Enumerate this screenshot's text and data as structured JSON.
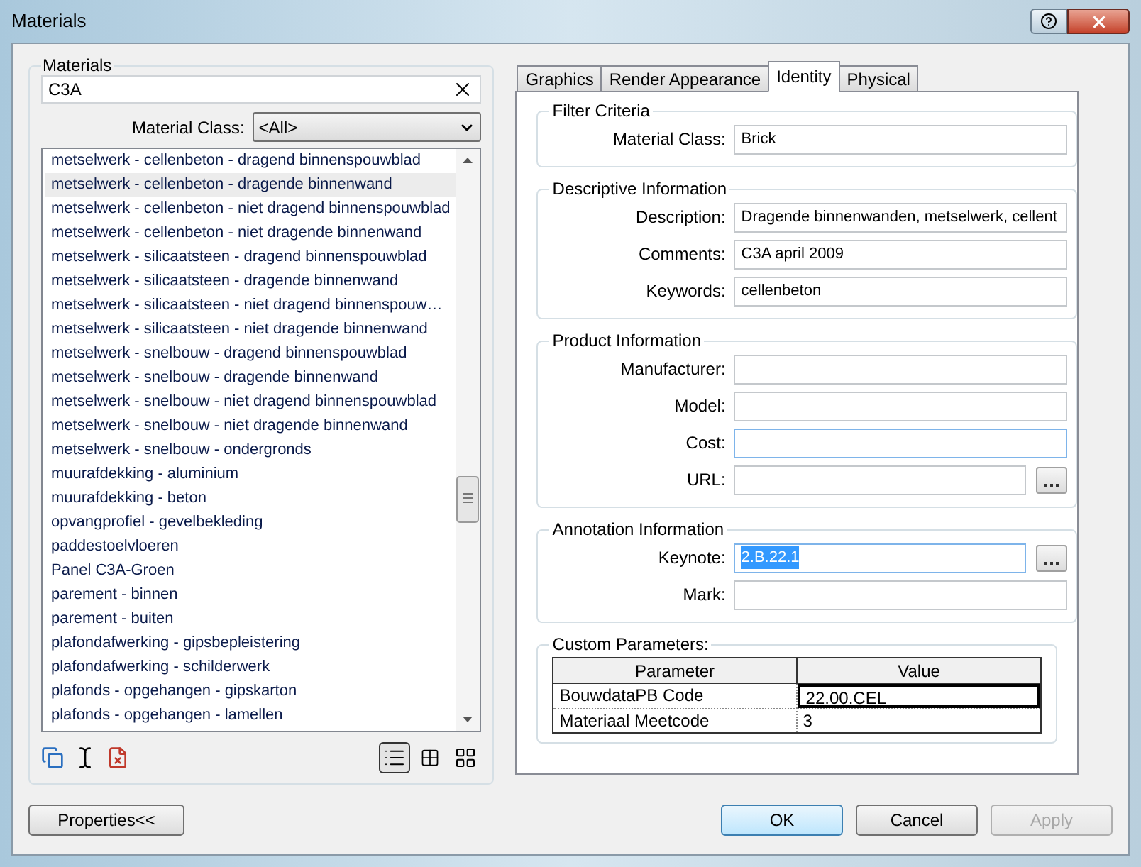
{
  "window": {
    "title": "Materials"
  },
  "materials": {
    "title": "Materials",
    "search": {
      "value": "C3A"
    },
    "material_class": {
      "label": "Material Class:",
      "value": "<All>"
    },
    "items": [
      {
        "label": "metselwerk - cellenbeton - dragend binnenspouwblad",
        "selected": false
      },
      {
        "label": "metselwerk - cellenbeton - dragende binnenwand",
        "selected": true
      },
      {
        "label": "metselwerk - cellenbeton - niet dragend binnenspouwblad",
        "selected": false
      },
      {
        "label": "metselwerk - cellenbeton - niet dragende binnenwand",
        "selected": false
      },
      {
        "label": "metselwerk - silicaatsteen - dragend binnenspouwblad",
        "selected": false
      },
      {
        "label": "metselwerk - silicaatsteen - dragende binnenwand",
        "selected": false
      },
      {
        "label": "metselwerk - silicaatsteen - niet dragend binnenspouw…",
        "selected": false
      },
      {
        "label": "metselwerk - silicaatsteen - niet dragende binnenwand",
        "selected": false
      },
      {
        "label": "metselwerk - snelbouw - dragend binnenspouwblad",
        "selected": false
      },
      {
        "label": "metselwerk - snelbouw - dragende binnenwand",
        "selected": false
      },
      {
        "label": "metselwerk - snelbouw - niet dragend binnenspouwblad",
        "selected": false
      },
      {
        "label": "metselwerk - snelbouw - niet dragende binnenwand",
        "selected": false
      },
      {
        "label": "metselwerk - snelbouw - ondergronds",
        "selected": false
      },
      {
        "label": "muurafdekking - aluminium",
        "selected": false
      },
      {
        "label": "muurafdekking - beton",
        "selected": false
      },
      {
        "label": "opvangprofiel - gevelbekleding",
        "selected": false
      },
      {
        "label": "paddestoelvloeren",
        "selected": false
      },
      {
        "label": "Panel C3A-Groen",
        "selected": false
      },
      {
        "label": "parement - binnen",
        "selected": false
      },
      {
        "label": "parement - buiten",
        "selected": false
      },
      {
        "label": "plafondafwerking - gipsbepleistering",
        "selected": false
      },
      {
        "label": "plafondafwerking - schilderwerk",
        "selected": false
      },
      {
        "label": "plafonds - opgehangen - gipskarton",
        "selected": false
      },
      {
        "label": "plafonds - opgehangen - lamellen",
        "selected": false
      }
    ],
    "view_buttons": [
      {
        "kind": "list",
        "selected": true
      },
      {
        "kind": "small",
        "selected": false
      },
      {
        "kind": "large",
        "selected": false
      }
    ]
  },
  "properties_button": {
    "label": "Properties<<"
  },
  "tabs": [
    {
      "label": "Graphics",
      "selected": false
    },
    {
      "label": "Render Appearance",
      "selected": false
    },
    {
      "label": "Identity",
      "selected": true
    },
    {
      "label": "Physical",
      "selected": false
    }
  ],
  "groups": [
    {
      "title": "Filter Criteria",
      "fields": [
        {
          "label": "Material Class:",
          "value": "Brick",
          "kind": "text",
          "highlighted": false,
          "value_selected": false
        }
      ]
    },
    {
      "title": "Descriptive Information",
      "fields": [
        {
          "label": "Description:",
          "value": "Dragende binnenwanden, metselwerk, cellent",
          "kind": "text",
          "highlighted": false,
          "value_selected": false
        },
        {
          "label": "Comments:",
          "value": "C3A april 2009",
          "kind": "text",
          "highlighted": false,
          "value_selected": false
        },
        {
          "label": "Keywords:",
          "value": "cellenbeton",
          "kind": "text",
          "highlighted": false,
          "value_selected": false
        }
      ]
    },
    {
      "title": "Product Information",
      "fields": [
        {
          "label": "Manufacturer:",
          "kind": "text",
          "highlighted": false
        },
        {
          "label": "Model:",
          "kind": "text",
          "highlighted": false
        },
        {
          "label": "Cost:",
          "kind": "text",
          "highlighted": true
        },
        {
          "label": "URL:",
          "kind": "browse",
          "highlighted": false
        }
      ]
    },
    {
      "title": "Annotation Information",
      "fields": [
        {
          "label": "Keynote:",
          "value": "2.B.22.1",
          "kind": "browse",
          "highlighted": true,
          "value_selected": true
        },
        {
          "label": "Mark:",
          "kind": "text",
          "highlighted": false
        }
      ]
    }
  ],
  "custom_parameters": {
    "title": "Custom Parameters:",
    "columns": [
      "Parameter",
      "Value"
    ],
    "rows": [
      {
        "cells": [
          "BouwdataPB Code",
          "22.00.CEL"
        ],
        "selected": true
      },
      {
        "cells": [
          "Materiaal Meetcode",
          "3"
        ],
        "selected": false
      }
    ]
  },
  "buttons": [
    {
      "label": "OK",
      "kind": "default",
      "disabled": false
    },
    {
      "label": "Cancel",
      "kind": "normal",
      "disabled": false
    },
    {
      "label": "Apply",
      "kind": "normal",
      "disabled": true
    }
  ]
}
